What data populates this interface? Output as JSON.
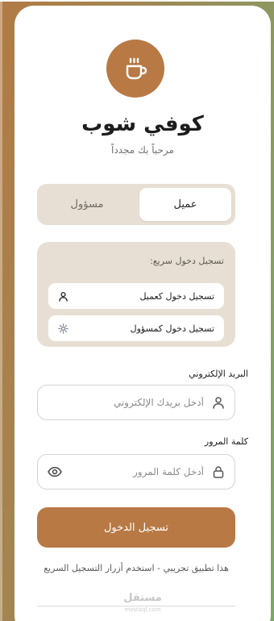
{
  "brand": {
    "name": "كوفي شوب",
    "tagline": "مرحباً بك مجدداً",
    "logo_icon": "coffee-cup-icon",
    "accent_color": "#b87944"
  },
  "role_tabs": [
    {
      "label": "عميل",
      "selected": true
    },
    {
      "label": "مسؤول",
      "selected": false
    }
  ],
  "quick_login": {
    "title": "تسجيل دخول سريع:",
    "customer_label": "تسجيل دخول كعميل",
    "customer_icon": "user-icon",
    "admin_label": "تسجيل دخول كمسؤول",
    "admin_icon": "gear-icon"
  },
  "form": {
    "email_label": "البريد الإلكتروني",
    "email_placeholder": "أدخل بريدك الإلكتروني",
    "email_icon": "user-icon",
    "password_label": "كلمة المرور",
    "password_placeholder": "أدخل كلمة المرور",
    "password_icon": "lock-icon",
    "password_toggle_icon": "eye-icon",
    "submit_label": "تسجيل الدخول"
  },
  "note": "هذا تطبيق تجريبي - استخدم أزرار التسجيل السريع",
  "watermark": {
    "text": "مستقل",
    "sub": "mostaql.com"
  }
}
